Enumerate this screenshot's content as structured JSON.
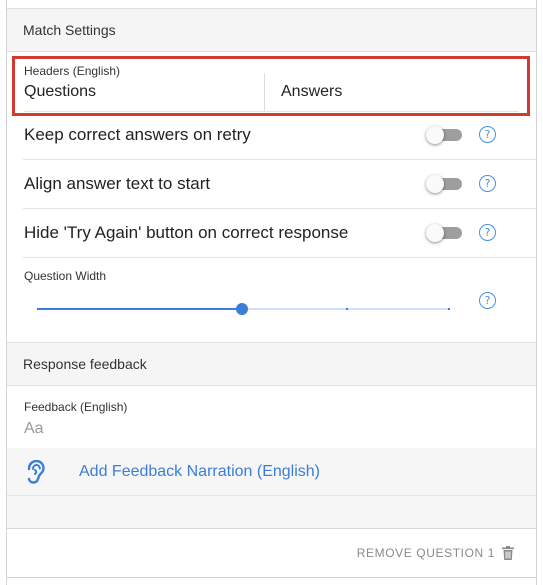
{
  "match_settings": {
    "title": "Match Settings",
    "headers": {
      "label": "Headers (English)",
      "questions": "Questions",
      "answers": "Answers"
    },
    "toggles": [
      {
        "label": "Keep correct answers on retry",
        "on": false
      },
      {
        "label": "Align answer text to start",
        "on": false
      },
      {
        "label": "Hide 'Try Again' button on correct response",
        "on": false
      }
    ],
    "question_width": {
      "label": "Question Width",
      "value_fraction": 0.5
    }
  },
  "response_feedback": {
    "title": "Response feedback",
    "feedback_label": "Feedback (English)",
    "feedback_placeholder": "Aa",
    "narration_link": "Add Feedback Narration (English)"
  },
  "footer": {
    "remove_label": "REMOVE QUESTION 1"
  },
  "icons": {
    "help": "help-icon",
    "ear": "ear-icon",
    "trash": "trash-icon"
  },
  "colors": {
    "highlight_border": "#d23a2f",
    "accent_blue": "#3b7dd8"
  }
}
